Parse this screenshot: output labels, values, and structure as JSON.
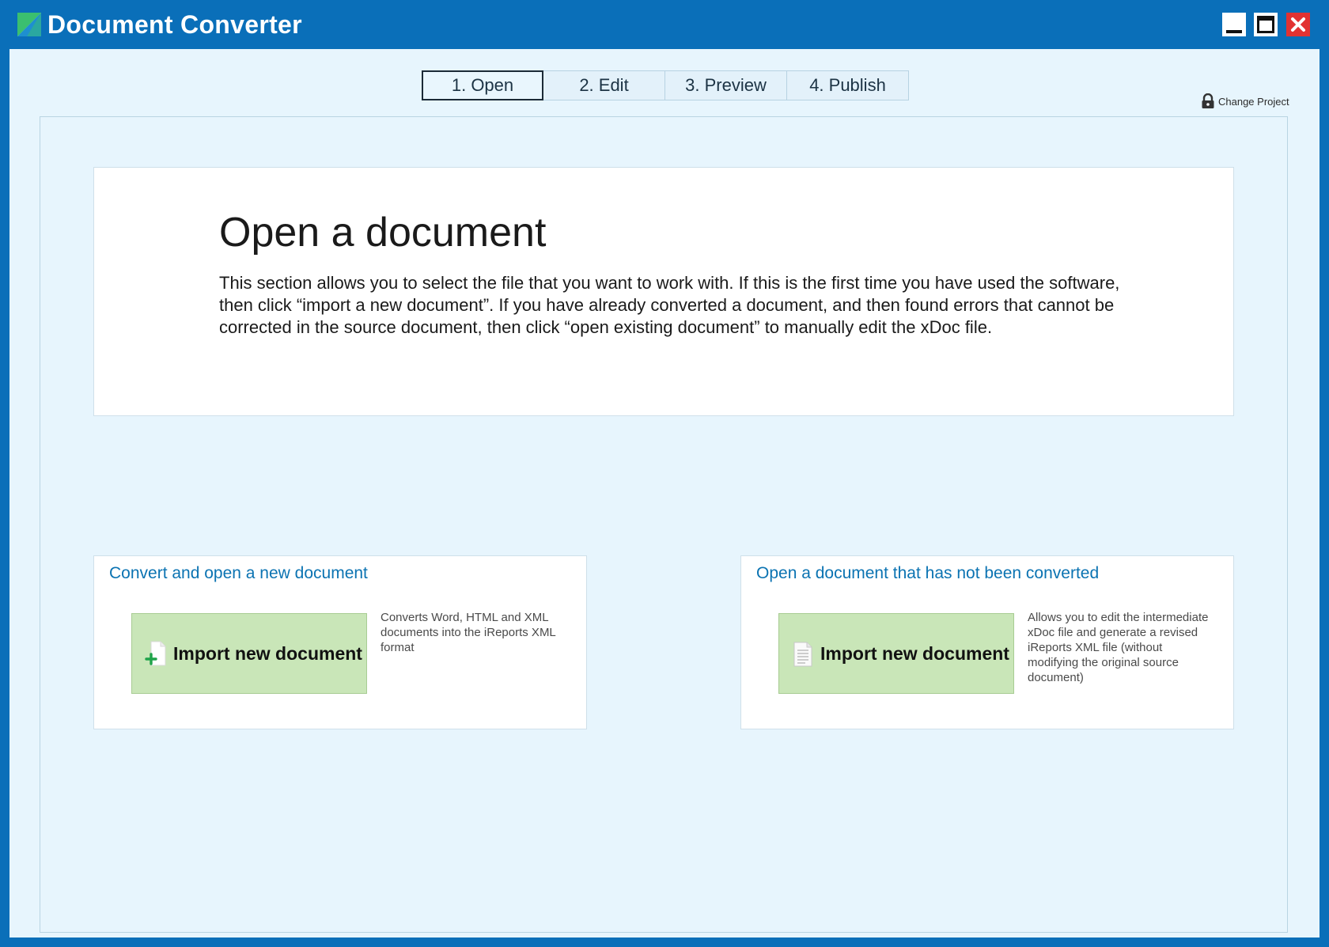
{
  "window": {
    "title": "Document Converter",
    "controls": {
      "minimize": "minimize",
      "maximize": "maximize",
      "close": "close"
    }
  },
  "tabs": [
    {
      "label": "1. Open",
      "active": true
    },
    {
      "label": "2. Edit",
      "active": false
    },
    {
      "label": "3. Preview",
      "active": false
    },
    {
      "label": "4. Publish",
      "active": false
    }
  ],
  "change_project": {
    "label": "Change Project",
    "icon": "lock-icon"
  },
  "intro": {
    "title": "Open a document",
    "text": "This section allows you to select the file that you want to work with. If this is the first time you have used the software, then click “import a new document”. If you have already converted a document, and then found errors that cannot be corrected in the source document, then click “open existing document” to manually edit the xDoc file."
  },
  "cards": {
    "convert": {
      "title": "Convert and open a new document",
      "button_label": "Import new document",
      "button_icon": "document-plus-icon",
      "description": "Converts Word, HTML and XML documents into the iReports XML format"
    },
    "open_existing": {
      "title": "Open a document that has not been converted",
      "button_label": "Import new document",
      "button_icon": "document-icon",
      "description": "Allows you to edit the intermediate xDoc file and generate a revised iReports XML file (without modifying the original source document)"
    }
  },
  "colors": {
    "frame": "#0a6fb9",
    "client_background": "#e7f5fd",
    "button_green": "#c9e6b8",
    "card_title_blue": "#0b73b2",
    "close_red": "#e23232"
  }
}
